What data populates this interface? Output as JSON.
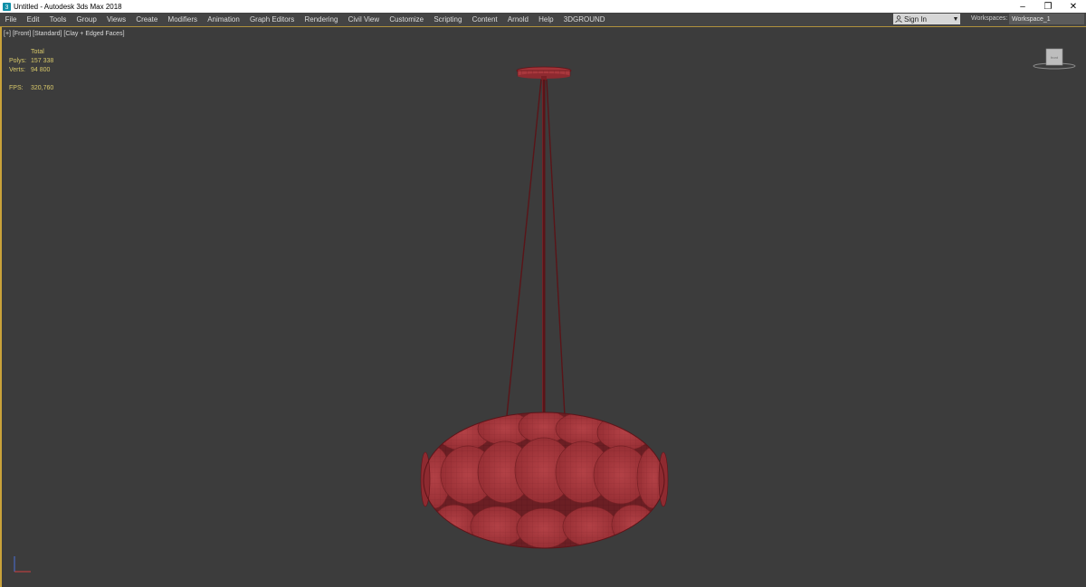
{
  "titlebar": {
    "title": "Untitled - Autodesk 3ds Max 2018",
    "minimize_glyph": "–",
    "restore_glyph": "❐",
    "close_glyph": "✕"
  },
  "menu": {
    "items": [
      "File",
      "Edit",
      "Tools",
      "Group",
      "Views",
      "Create",
      "Modifiers",
      "Animation",
      "Graph Editors",
      "Rendering",
      "Civil View",
      "Customize",
      "Scripting",
      "Content",
      "Arnold",
      "Help",
      "3DGROUND"
    ]
  },
  "account": {
    "sign_in_label": "Sign In",
    "workspaces_label": "Workspaces:",
    "workspace_value": "Workspace_1"
  },
  "viewport": {
    "label_plus": "[+]",
    "label_view": "[Front]",
    "label_shading_std": "[Standard]",
    "label_shading_mode": "[Clay + Edged Faces]",
    "stats": {
      "header": "Total",
      "polys_label": "Polys:",
      "polys_value": "157 338",
      "verts_label": "Verts:",
      "verts_value": "94 800",
      "fps_label": "FPS:",
      "fps_value": "320,760"
    },
    "viewcube_label": "front"
  },
  "colors": {
    "viewport_bg": "#3c3c3c",
    "menu_bg": "#444444",
    "accent": "#c9a23a",
    "model": "#a8383d"
  }
}
